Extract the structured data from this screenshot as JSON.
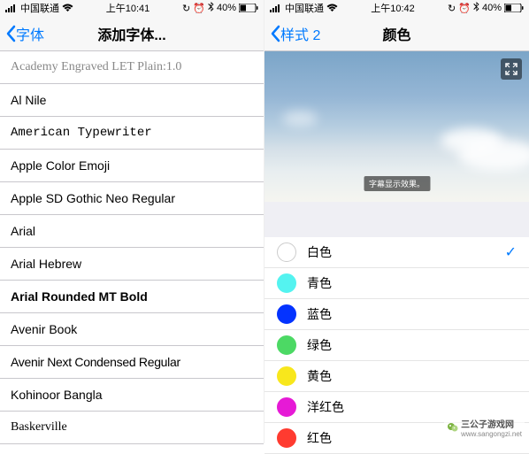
{
  "left": {
    "status": {
      "carrier": "中国联通",
      "time": "上午10:41",
      "battery": "40%"
    },
    "nav": {
      "back": "字体",
      "title": "添加字体..."
    },
    "fonts": [
      {
        "label": "Academy Engraved LET Plain:1.0",
        "cls": "font-academy"
      },
      {
        "label": "Al Nile",
        "cls": ""
      },
      {
        "label": "American Typewriter",
        "cls": "font-typewriter"
      },
      {
        "label": "Apple Color Emoji",
        "cls": ""
      },
      {
        "label": "Apple SD Gothic Neo Regular",
        "cls": ""
      },
      {
        "label": "Arial",
        "cls": ""
      },
      {
        "label": "Arial Hebrew",
        "cls": ""
      },
      {
        "label": "Arial Rounded MT Bold",
        "cls": "bold"
      },
      {
        "label": "Avenir Book",
        "cls": ""
      },
      {
        "label": "Avenir Next Condensed Regular",
        "cls": "font-avenir-next"
      },
      {
        "label": "Kohinoor Bangla",
        "cls": "font-kohinoor"
      },
      {
        "label": "Baskerville",
        "cls": "font-baskerville"
      }
    ]
  },
  "right": {
    "status": {
      "carrier": "中国联通",
      "time": "上午10:42",
      "battery": "40%"
    },
    "nav": {
      "back": "样式 2",
      "title": "颜色"
    },
    "subtitle": "字幕显示效果。",
    "colors": [
      {
        "label": "白色",
        "color": "#ffffff",
        "border": "#cccccc",
        "selected": true
      },
      {
        "label": "青色",
        "color": "#54f3f0",
        "border": "#54f3f0",
        "selected": false
      },
      {
        "label": "蓝色",
        "color": "#0433ff",
        "border": "#0433ff",
        "selected": false
      },
      {
        "label": "绿色",
        "color": "#4cd964",
        "border": "#4cd964",
        "selected": false
      },
      {
        "label": "黄色",
        "color": "#f8e71c",
        "border": "#f8e71c",
        "selected": false
      },
      {
        "label": "洋红色",
        "color": "#e61ad6",
        "border": "#e61ad6",
        "selected": false
      },
      {
        "label": "红色",
        "color": "#ff3b30",
        "border": "#ff3b30",
        "selected": false
      }
    ]
  },
  "watermark": {
    "text": "三公子游戏网",
    "url": "www.sangongzi.net"
  }
}
